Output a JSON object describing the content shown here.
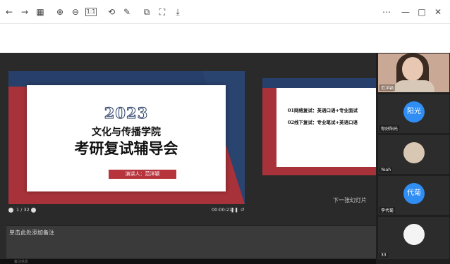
{
  "toolbar": {
    "icons": [
      "back-icon",
      "forward-icon",
      "grid-icon",
      "zoom-in-icon",
      "zoom-out-icon",
      "actual-size-icon",
      "rotate-icon",
      "edit-icon",
      "copy-icon",
      "screenshot-icon",
      "download-icon"
    ],
    "window": [
      "more-icon",
      "minimize-icon",
      "maximize-icon",
      "close-icon"
    ],
    "actual_size_label": "1:1"
  },
  "slide": {
    "year": "2023",
    "line1": "文化与传播学院",
    "line2": "考研复试辅导会",
    "speaker": "演讲人：范洋颖"
  },
  "next_slide": {
    "line1": "01网络复试：英语口语+专业面试",
    "line2": "02线下复试：专业笔试+英语口语"
  },
  "controls": {
    "page": "1 / 32",
    "timer": "00:00:21",
    "next_label": "下一张幻灯片"
  },
  "notes": {
    "placeholder": "单击此处添加备注"
  },
  "bottom": {
    "text": "备注信息"
  },
  "participants": [
    {
      "name": "范洋颖",
      "kind": "video"
    },
    {
      "name": "你好阳光",
      "avatar": "阳光",
      "color": "#2f8df3"
    },
    {
      "name": "Yeah",
      "avatar": "",
      "color": "#d8c7b2"
    },
    {
      "name": "李代菊",
      "avatar": "代菊",
      "color": "#2f8df3"
    },
    {
      "name": "33",
      "avatar": "",
      "color": "#f4f4f4"
    }
  ]
}
